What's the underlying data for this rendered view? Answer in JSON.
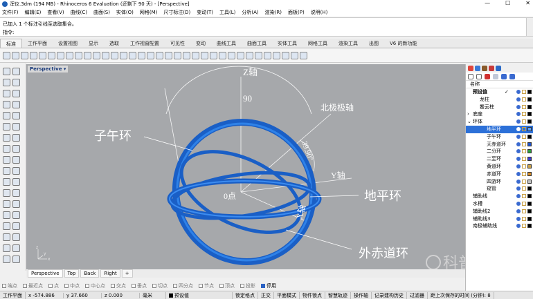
{
  "window": {
    "title": "浑仪.3dm (194 MB) - Rhinoceros 6 Evaluation (还剩下 90 天) - [Perspective]",
    "controls": [
      "—",
      "☐",
      "✕"
    ]
  },
  "menu": [
    "文件(F)",
    "编辑(E)",
    "查看(V)",
    "曲线(C)",
    "曲面(S)",
    "实体(O)",
    "网格(M)",
    "尺寸标注(D)",
    "变动(T)",
    "工具(L)",
    "分析(A)",
    "渲染(R)",
    "面板(P)",
    "说明(H)"
  ],
  "command": {
    "history": "已加入 1 个标注引线至选取集合。",
    "prompt": "指令:"
  },
  "tabs": [
    "标准",
    "工作平面",
    "设置视图",
    "显示",
    "选取",
    "工作视窗配置",
    "可见性",
    "变动",
    "曲线工具",
    "曲面工具",
    "实体工具",
    "网格工具",
    "渲染工具",
    "出图",
    "V6 的新功能"
  ],
  "viewport": {
    "label": "Perspective",
    "dropdown": "▾",
    "annotations": {
      "z_axis": "Z轴",
      "angle_90": "90",
      "north_axis": "北极极轴",
      "angle_39": "39.90°",
      "y_axis": "Y轴",
      "origin": "0点",
      "x_axis": "X轴",
      "meridian": "子午环",
      "horizon": "地平环",
      "equator": "外赤道环"
    },
    "watermark": "科普云",
    "axis_icon": {
      "x": "x",
      "y": "y",
      "z": "z"
    },
    "ring_color": "#1f6fd6"
  },
  "viewport_tabs": [
    "Perspective",
    "Top",
    "Back",
    "Right",
    "+"
  ],
  "snaps": [
    {
      "label": "端点",
      "on": false
    },
    {
      "label": "最近点",
      "on": false
    },
    {
      "label": "点",
      "on": false
    },
    {
      "label": "中点",
      "on": false
    },
    {
      "label": "中心点",
      "on": false
    },
    {
      "label": "交点",
      "on": false
    },
    {
      "label": "垂点",
      "on": false
    },
    {
      "label": "切点",
      "on": false
    },
    {
      "label": "四分点",
      "on": false
    },
    {
      "label": "节点",
      "on": false
    },
    {
      "label": "顶点",
      "on": false
    },
    {
      "label": "投影",
      "on": false
    },
    {
      "label": "停用",
      "on": true
    }
  ],
  "status": {
    "cplane": "工作平面",
    "x": "x -574.886",
    "y": "y 37.660",
    "z": "z 0.000",
    "unit": "毫米",
    "layer": "预设值",
    "items": [
      "锁定格点",
      "正交",
      "平面模式",
      "物件锁点",
      "智慧轨迹",
      "操作轴",
      "记录建构历史",
      "过滤器",
      "距上次保存的时间 (分钟): 8"
    ]
  },
  "layers": {
    "header": "名称",
    "rows": [
      {
        "name": "预设值",
        "indent": 0,
        "bold": true,
        "check": "✓",
        "color": "#000000"
      },
      {
        "name": "龙柱",
        "indent": 1,
        "color": "#000000"
      },
      {
        "name": "鳌云柱",
        "indent": 1,
        "color": "#000000"
      },
      {
        "name": "底座",
        "indent": 0,
        "expander": "›",
        "color": "#000000"
      },
      {
        "name": "环体",
        "indent": 0,
        "expander": "⌄",
        "color": "#000000"
      },
      {
        "name": "地平环",
        "indent": 2,
        "selected": true,
        "color": "#5aa0ff"
      },
      {
        "name": "子午环",
        "indent": 2,
        "color": "#000000"
      },
      {
        "name": "天赤道环",
        "indent": 2,
        "color": "#1e50c8"
      },
      {
        "name": "二分环",
        "indent": 2,
        "color": "#2c9a3c"
      },
      {
        "name": "二至环",
        "indent": 2,
        "color": "#3c3ccc"
      },
      {
        "name": "黄道环",
        "indent": 2,
        "color": "#c8a046"
      },
      {
        "name": "赤道环",
        "indent": 2,
        "color": "#d08a2a"
      },
      {
        "name": "四游环",
        "indent": 2,
        "color": "#c0c0c0"
      },
      {
        "name": "窥管",
        "indent": 2,
        "color": "#000000"
      },
      {
        "name": "辅助线",
        "indent": 0,
        "color": "#000000"
      },
      {
        "name": "水槽",
        "indent": 0,
        "color": "#000000"
      },
      {
        "name": "辅助线2",
        "indent": 0,
        "color": "#000000"
      },
      {
        "name": "辅助线3",
        "indent": 0,
        "color": "#000000"
      },
      {
        "name": "南极辅助线",
        "indent": 0,
        "color": "#000000"
      }
    ]
  }
}
